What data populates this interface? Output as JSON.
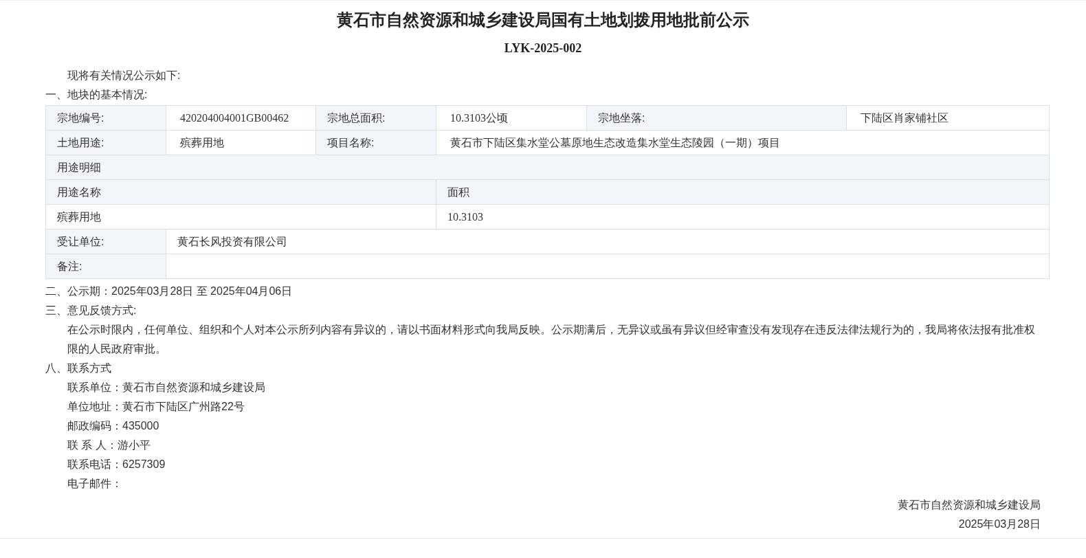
{
  "title": "黄石市自然资源和城乡建设局国有土地划拨用地批前公示",
  "code": "LYK-2025-002",
  "intro": "现将有关情况公示如下:",
  "section1": {
    "heading": "一、地块的基本情况:"
  },
  "parcel": {
    "number": {
      "label": "宗地编号:",
      "value": "420204004001GB00462"
    },
    "total_area": {
      "label": "宗地总面积:",
      "value": "10.3103公顷"
    },
    "location": {
      "label": "宗地坐落:",
      "value": "下陆区肖家铺社区"
    },
    "land_use": {
      "label": "土地用途:",
      "value": "殡葬用地"
    },
    "project_name": {
      "label": "项目名称:",
      "value": "黄石市下陆区集水堂公墓原地生态改造集水堂生态陵园（一期）项目"
    }
  },
  "use_details": {
    "title": "用途明细",
    "columns": [
      "用途名称",
      "面积"
    ],
    "rows": [
      [
        "殡葬用地",
        "10.3103"
      ]
    ]
  },
  "transferee": {
    "label": "受让单位:",
    "value": "黄石长风投资有限公司"
  },
  "remarks": {
    "label": "备注:"
  },
  "period": "二、公示期：2025年03月28日 至 2025年04月06日",
  "feedback": {
    "heading": "三、意见反馈方式:",
    "text": "在公示时限内，任何单位、组织和个人对本公示所列内容有异议的，请以书面材料形式向我局反映。公示期满后，无异议或虽有异议但经审查没有发现存在违反法律法规行为的，我局将依法报有批准权限的人民政府审批。"
  },
  "contact": {
    "heading": "八、联系方式",
    "items": [
      "联系单位：黄石市自然资源和城乡建设局",
      "单位地址：黄石市下陆区广州路22号",
      "邮政编码：435000",
      "联 系 人：游小平",
      "联系电话：6257309",
      "电子邮件："
    ]
  },
  "signature": {
    "org": "黄石市自然资源和城乡建设局",
    "date": "2025年03月28日"
  }
}
